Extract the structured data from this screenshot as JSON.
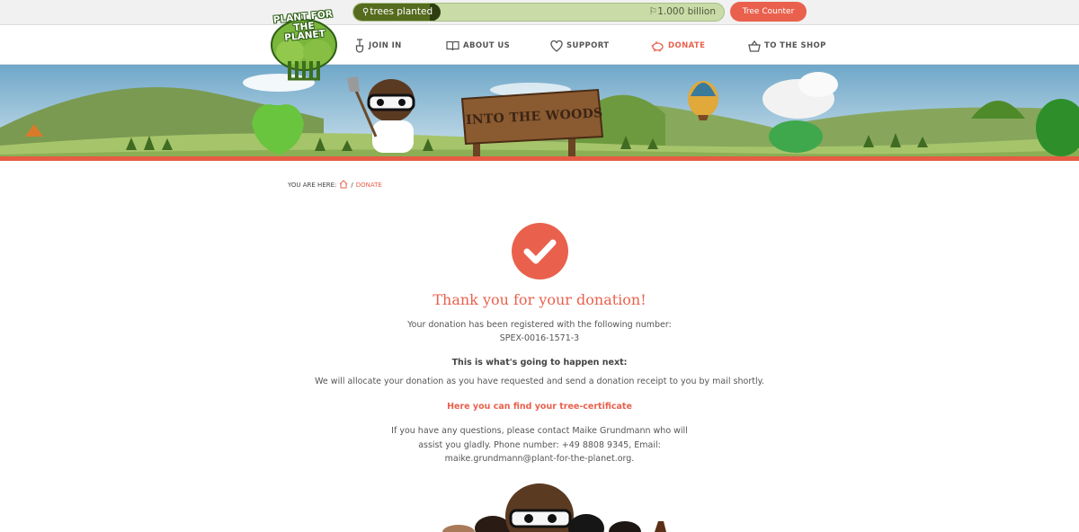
{
  "counter": {
    "label": "trees planted",
    "goal": "1.000 billion",
    "progress": 0.22,
    "button": "Tree Counter"
  },
  "logo": {
    "text": "PLANT FOR THE PLANET",
    "icon": "tree-crowd-logo"
  },
  "nav": [
    {
      "label": "JOIN IN",
      "icon": "shovel-icon"
    },
    {
      "label": "ABOUT US",
      "icon": "book-icon"
    },
    {
      "label": "SUPPORT",
      "icon": "heart-icon"
    },
    {
      "label": "DONATE",
      "icon": "piggy-bank-icon",
      "active": true
    },
    {
      "label": "TO THE SHOP",
      "icon": "basket-icon"
    }
  ],
  "banner": {
    "sign": "INTO THE WOODS"
  },
  "breadcrumb": {
    "prefix": "YOU ARE HERE:",
    "separator": "/",
    "current": "DONATE"
  },
  "content": {
    "title": "Thank you for your donation!",
    "registered": "Your donation has been registered with the following number:",
    "number": "SPEX-0016-1571-3",
    "next_heading": "This is what's going to happen next:",
    "allocate": "We will allocate your donation as you have requested and send a donation receipt to you by mail shortly.",
    "certificate_link": "Here you can find your tree-certificate",
    "contact": "If you have any questions, please contact Maike Grundmann who will assist you gladly. Phone number: +49 8808 9345, Email: maike.grundmann@plant-for-the-planet.org."
  },
  "colors": {
    "accent": "#e9614d",
    "counter_fill": "#556b1e",
    "counter_bg": "#c9dca8"
  }
}
